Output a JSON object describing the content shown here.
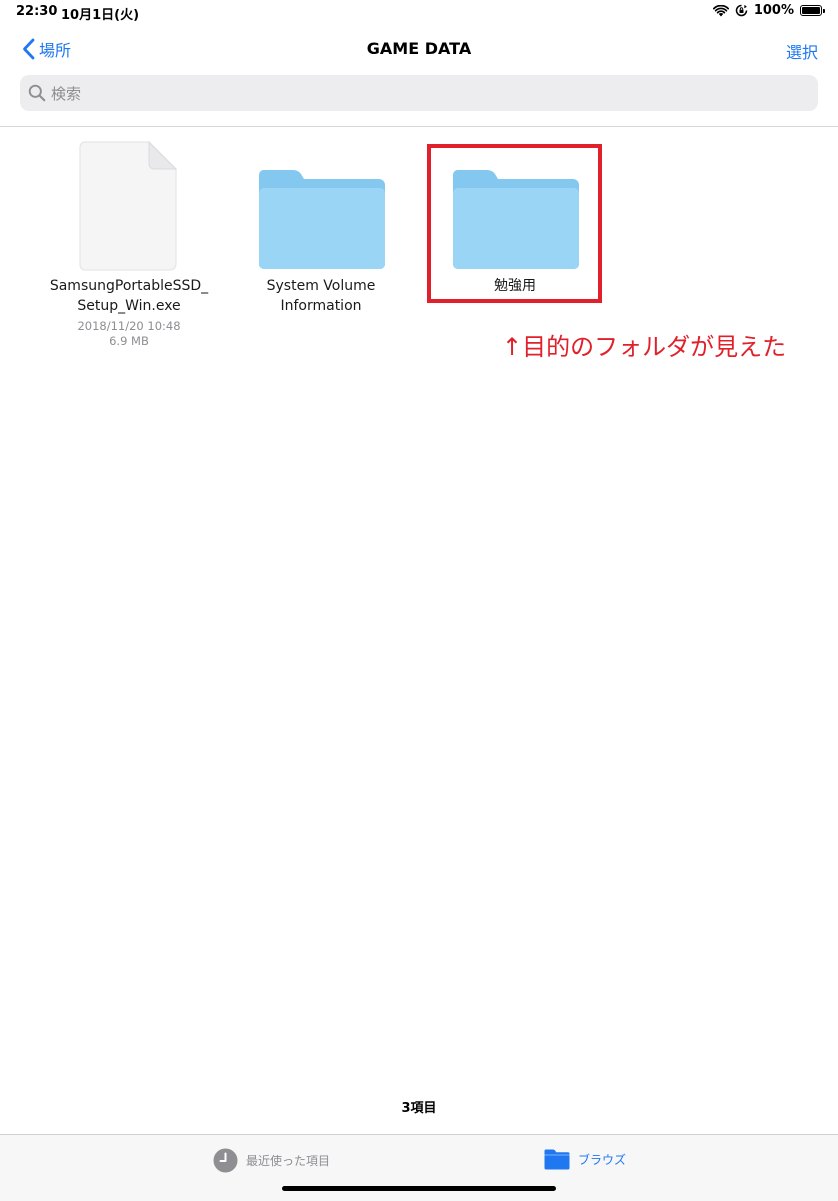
{
  "status_bar": {
    "time": "22:30",
    "date": "10月1日(火)",
    "battery": "100%",
    "battery_level": 1.0,
    "icons": [
      "wifi-icon",
      "orientation-lock-icon",
      "battery-icon"
    ]
  },
  "nav": {
    "back_label": "場所",
    "title": "GAME DATA",
    "select_label": "選択"
  },
  "search": {
    "placeholder": "検索"
  },
  "items": [
    {
      "name_line1": "SamsungPortableSSD_",
      "name_line2": "Setup_Win.exe",
      "date": "2018/11/20 10:48",
      "size": "6.9 MB",
      "icon": "document-icon"
    },
    {
      "name_line1": "System Volume",
      "name_line2": "Information",
      "icon": "folder-icon"
    },
    {
      "name_line1": "勉強用",
      "icon": "folder-icon"
    }
  ],
  "annotation": "↑目的のフォルダが見えた",
  "item_count": "3項目",
  "tabbar": {
    "recents_label": "最近使った項目",
    "browse_label": "ブラウズ"
  },
  "colors": {
    "accent": "#1f78f0",
    "annotation_red": "#e0212b",
    "folder": "#8ecdf2"
  }
}
